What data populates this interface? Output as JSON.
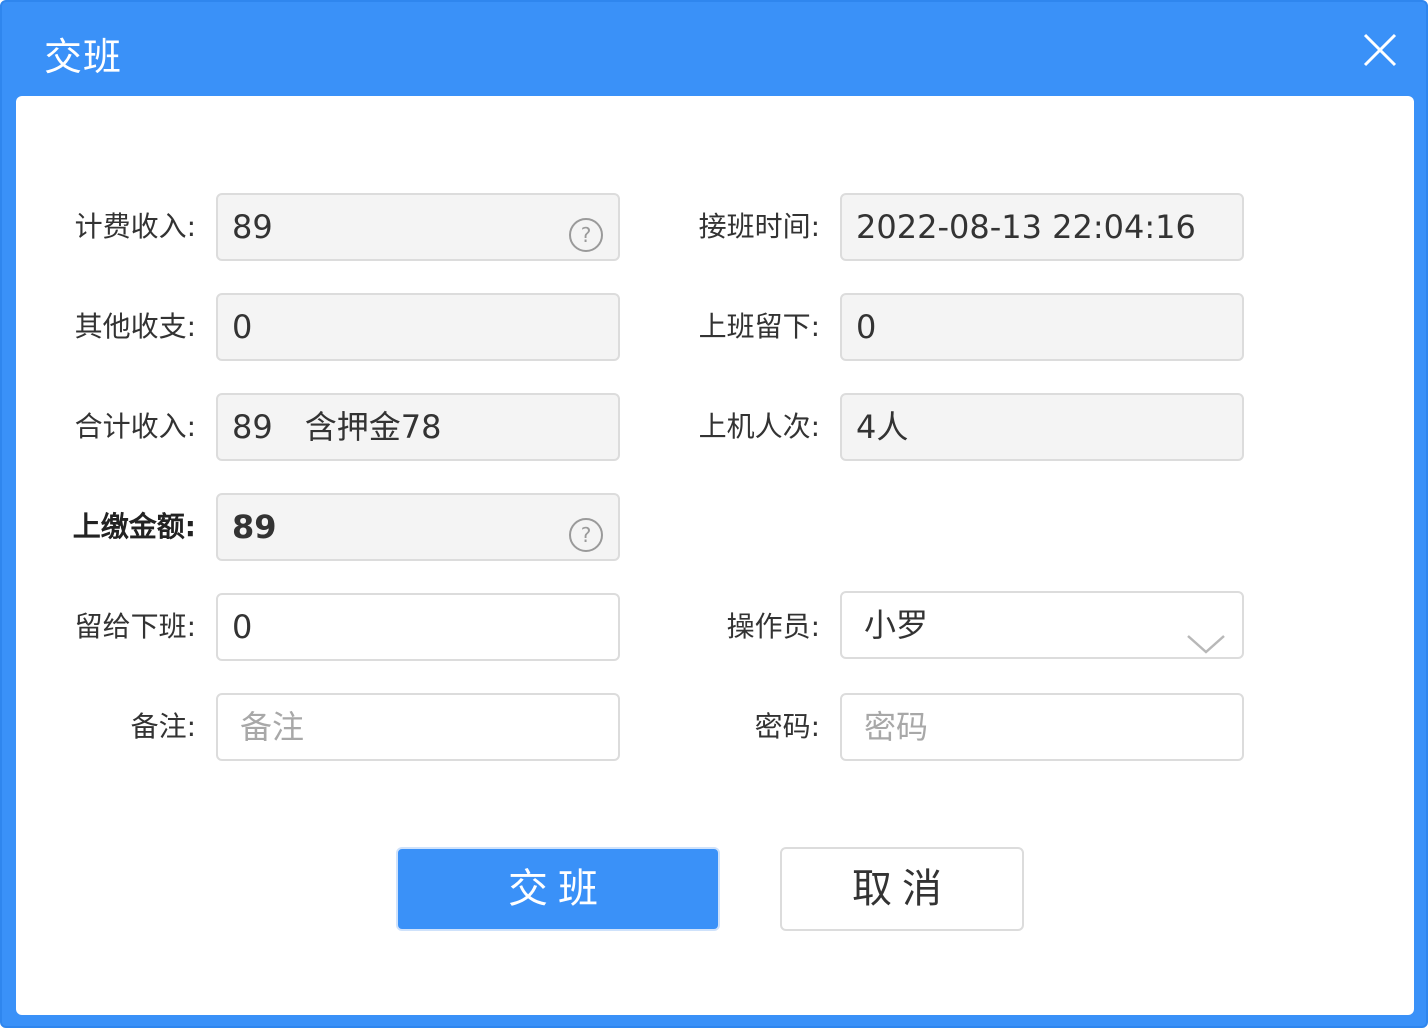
{
  "dialog": {
    "title": "交班",
    "close_icon": "close-icon"
  },
  "form": {
    "billing_income": {
      "label": "计费收入:",
      "value": "89",
      "icon": "help-icon"
    },
    "shift_start_time": {
      "label": "接班时间:",
      "value": "2022-08-13 22:04:16"
    },
    "other_income": {
      "label": "其他收支:",
      "value": "0"
    },
    "left_from_previous": {
      "label": "上班留下:",
      "value": "0"
    },
    "total_income": {
      "label": "合计收入:",
      "value": "89　含押金78"
    },
    "user_sessions": {
      "label": "上机人次:",
      "value": "4人"
    },
    "handover_amount": {
      "label": "上缴金额:",
      "value": "89",
      "icon": "help-icon"
    },
    "leave_for_next": {
      "label": "留给下班:",
      "value": "0"
    },
    "operator": {
      "label": "操作员:",
      "value": "小罗",
      "icon": "chevron-down-icon"
    },
    "remark": {
      "label": "备注:",
      "placeholder": "备注"
    },
    "password": {
      "label": "密码:",
      "placeholder": "密码"
    }
  },
  "buttons": {
    "confirm": "交班",
    "cancel": "取消"
  },
  "colors": {
    "accent": "#3a91f8",
    "field_bg": "#f4f4f4",
    "border": "#dcdcdc"
  }
}
